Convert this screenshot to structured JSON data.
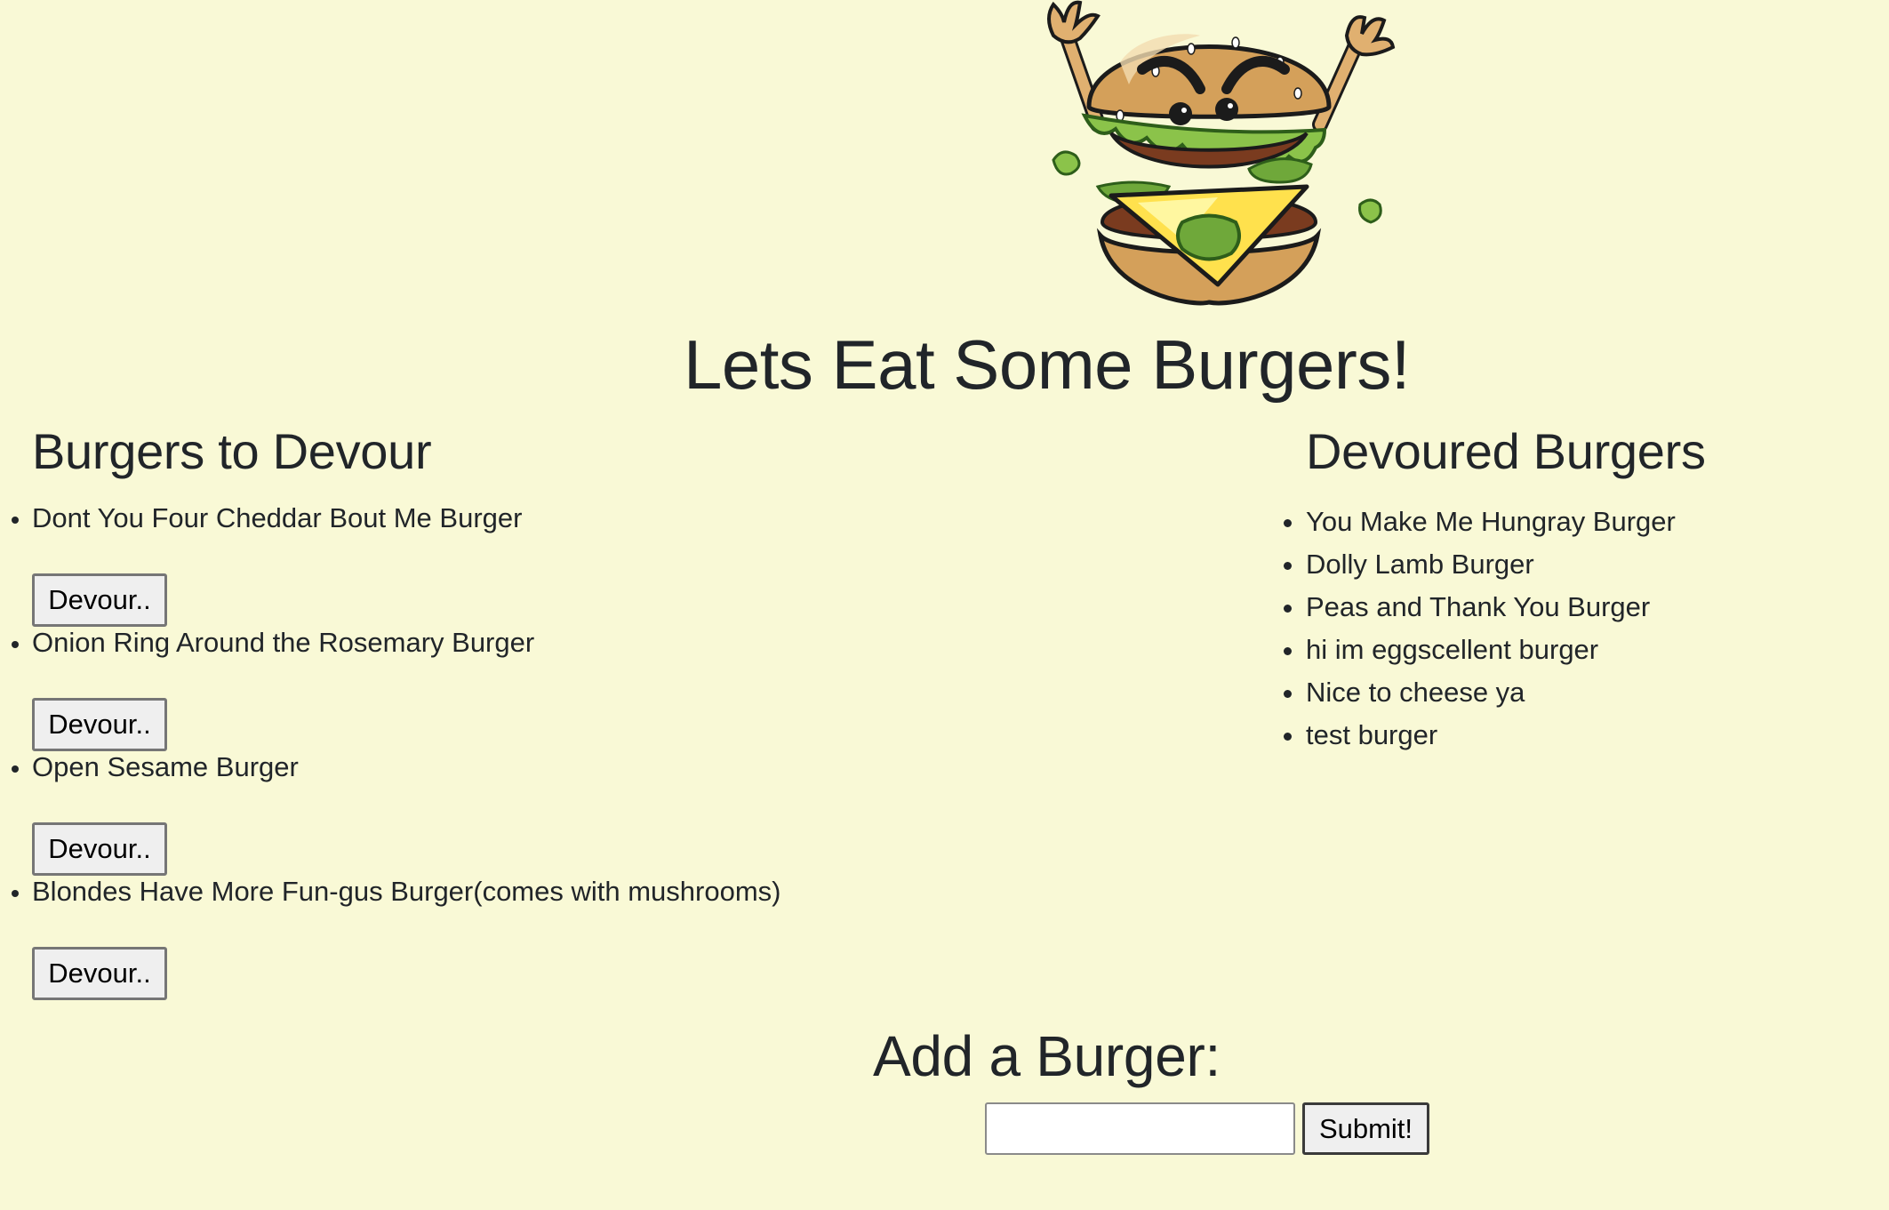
{
  "header": {
    "logo": "angry-burger-mascot-icon",
    "title": "Lets Eat Some Burgers!"
  },
  "to_devour": {
    "heading": "Burgers to Devour",
    "items": [
      {
        "name": "Dont You Four Cheddar Bout Me Burger",
        "button": "Devour.."
      },
      {
        "name": "Onion Ring Around the Rosemary Burger",
        "button": "Devour.."
      },
      {
        "name": "Open Sesame Burger",
        "button": "Devour.."
      },
      {
        "name": "Blondes Have More Fun-gus Burger(comes with mushrooms)",
        "button": "Devour.."
      }
    ]
  },
  "devoured": {
    "heading": "Devoured Burgers",
    "items": [
      "You Make Me Hungray Burger",
      "Dolly Lamb Burger",
      "Peas and Thank You Burger",
      "hi im eggscellent burger",
      "Nice to cheese ya",
      "test burger"
    ]
  },
  "add_burger": {
    "heading": "Add a Burger:",
    "input_value": "",
    "submit_label": "Submit!"
  },
  "colors": {
    "background": "#f9f9d6",
    "text": "#212529"
  }
}
